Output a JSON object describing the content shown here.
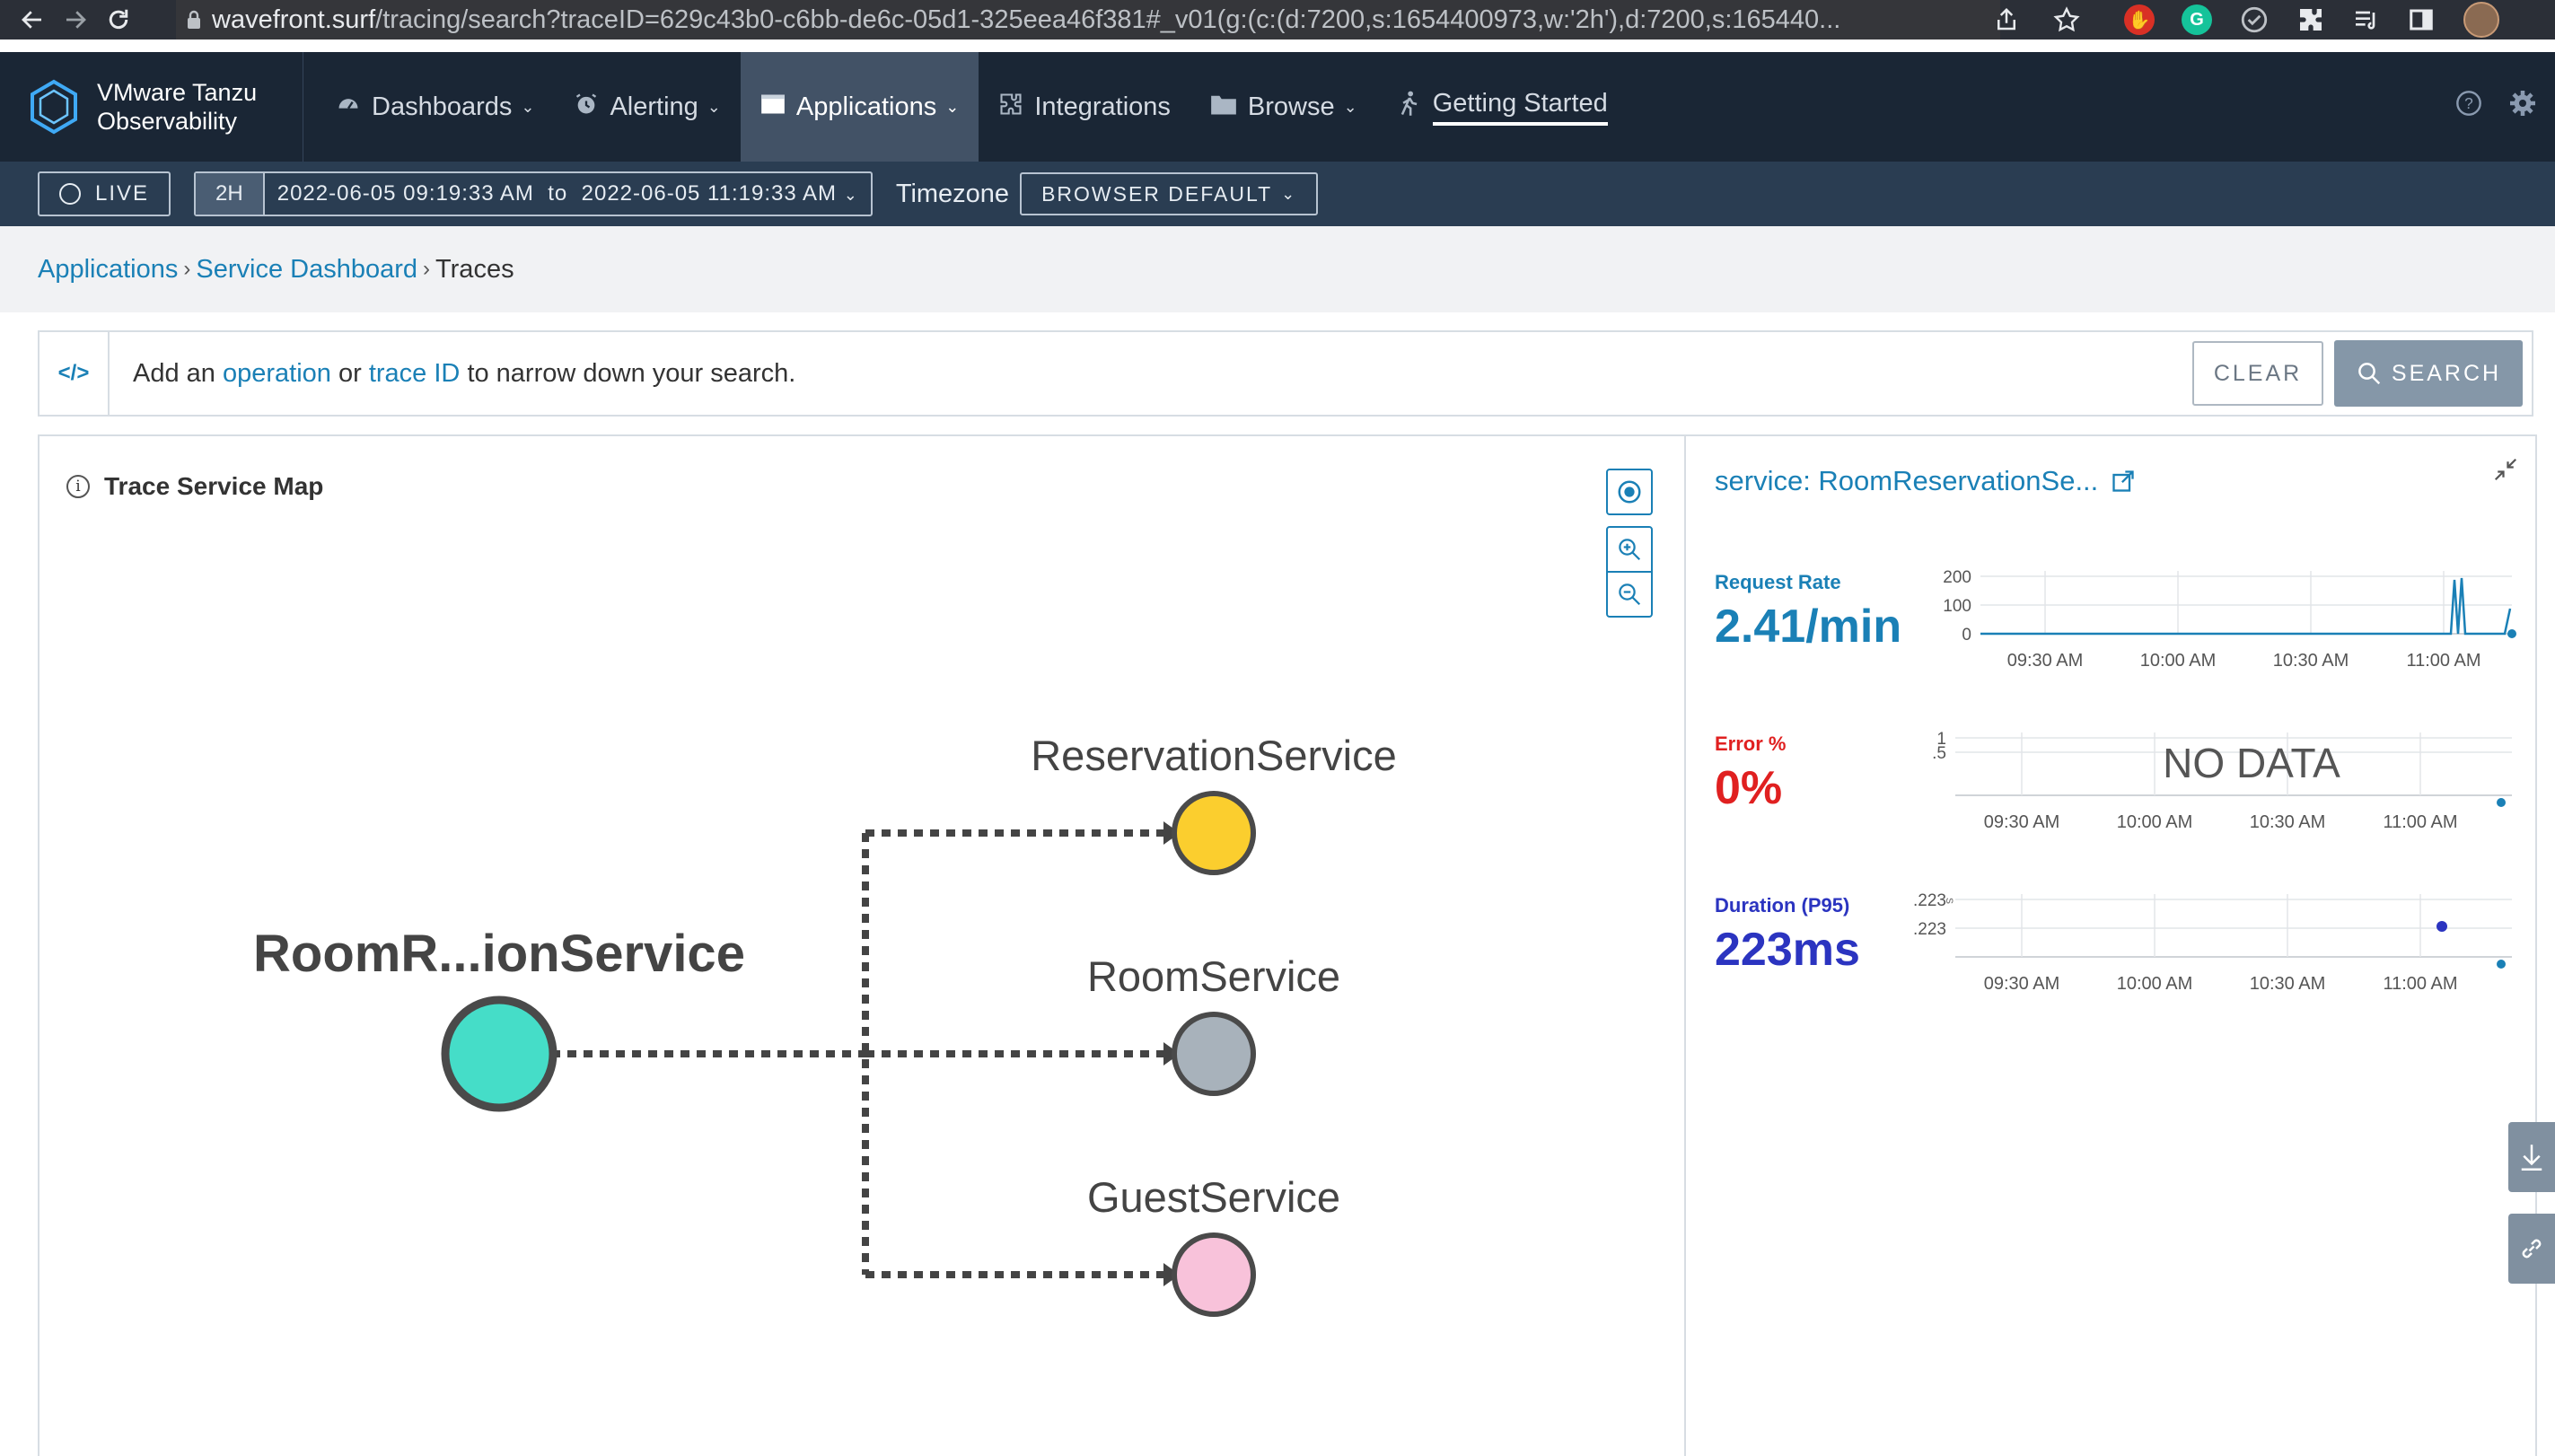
{
  "browser": {
    "url_host": "wavefront.surf",
    "url_path": "/tracing/search?traceID=629c43b0-c6bb-de6c-05d1-325eea46f381#_v01(g:(c:(d:7200,s:1654400973,w:'2h'),d:7200,s:165440..."
  },
  "app": {
    "brand_line1": "VMware Tanzu",
    "brand_line2": "Observability",
    "nav": [
      {
        "label": "Dashboards",
        "caret": true
      },
      {
        "label": "Alerting",
        "caret": true
      },
      {
        "label": "Applications",
        "caret": true,
        "active": true
      },
      {
        "label": "Integrations",
        "caret": false
      },
      {
        "label": "Browse",
        "caret": true
      },
      {
        "label": "Getting Started",
        "caret": false
      }
    ]
  },
  "timebar": {
    "live": "LIVE",
    "duration": "2H",
    "start": "2022-06-05 09:19:33 AM",
    "to": "to",
    "end": "2022-06-05 11:19:33 AM",
    "timezone_label": "Timezone",
    "timezone_value": "BROWSER DEFAULT"
  },
  "breadcrumb": {
    "items": [
      "Applications",
      "Service Dashboard"
    ],
    "current": "Traces"
  },
  "search": {
    "code_toggle": "</>",
    "hint_prefix": "Add an",
    "hint_kw1": "operation",
    "hint_mid": "or",
    "hint_kw2": "trace ID",
    "hint_suffix": "to narrow down your search.",
    "clear_label": "CLEAR",
    "search_label": "SEARCH"
  },
  "service_map": {
    "title": "Trace Service Map",
    "root": {
      "name": "RoomR...ionService",
      "color": "#45ddc8"
    },
    "children": [
      {
        "name": "ReservationService",
        "color": "#fbce2e"
      },
      {
        "name": "RoomService",
        "color": "#a8b2bb"
      },
      {
        "name": "GuestService",
        "color": "#f8c2da"
      }
    ]
  },
  "side_panel": {
    "service_title": "service: RoomReservationSe...",
    "time_ticks": [
      "09:30 AM",
      "10:00 AM",
      "10:30 AM",
      "11:00 AM"
    ],
    "metrics": [
      {
        "label": "Request Rate",
        "value": "2.41/min",
        "color": "#1a80b6",
        "y_ticks": [
          "200",
          "100",
          "0"
        ]
      },
      {
        "label": "Error %",
        "value": "0%",
        "color": "#e02020",
        "y_ticks": [
          "1",
          ".5"
        ],
        "no_data": "NO DATA"
      },
      {
        "label": "Duration (P95)",
        "value": "223ms",
        "color": "#2b34c0",
        "y_ticks": [
          ".223",
          ".223"
        ],
        "y_unit": "s"
      }
    ]
  }
}
